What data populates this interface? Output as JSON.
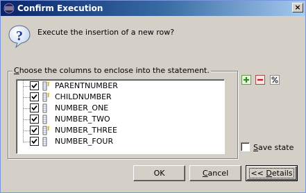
{
  "window": {
    "title": "Confirm Execution",
    "close_glyph": "×"
  },
  "dialog": {
    "question": "Execute the insertion of a new row?"
  },
  "columns_group": {
    "label_first": "C",
    "label_rest": "hoose the columns to enclose into the statement.",
    "items": [
      {
        "label": "PARENTNUMBER",
        "checked": true,
        "icon": "key-column-icon"
      },
      {
        "label": "CHILDNUMBER",
        "checked": true,
        "icon": "key-column-icon"
      },
      {
        "label": "NUMBER_ONE",
        "checked": true,
        "icon": "column-icon"
      },
      {
        "label": "NUMBER_TWO",
        "checked": true,
        "icon": "column-icon"
      },
      {
        "label": "NUMBER_THREE",
        "checked": true,
        "icon": "key-column-icon"
      },
      {
        "label": "NUMBER_FOUR",
        "checked": true,
        "icon": "column-icon"
      }
    ]
  },
  "toolbar": {
    "add_icon": "add-icon",
    "remove_icon": "remove-icon",
    "toggle_icon": "percent-icon"
  },
  "save_state": {
    "label_first": "S",
    "label_rest": "ave state",
    "checked": false
  },
  "buttons": {
    "ok": "OK",
    "cancel_first": "C",
    "cancel_rest": "ancel",
    "details_pre": "<< ",
    "details_first": "D",
    "details_rest": "etails"
  },
  "colors": {
    "title_start": "#0a246a",
    "title_end": "#a6caf0",
    "dialog_bg": "#d4d0c8"
  }
}
